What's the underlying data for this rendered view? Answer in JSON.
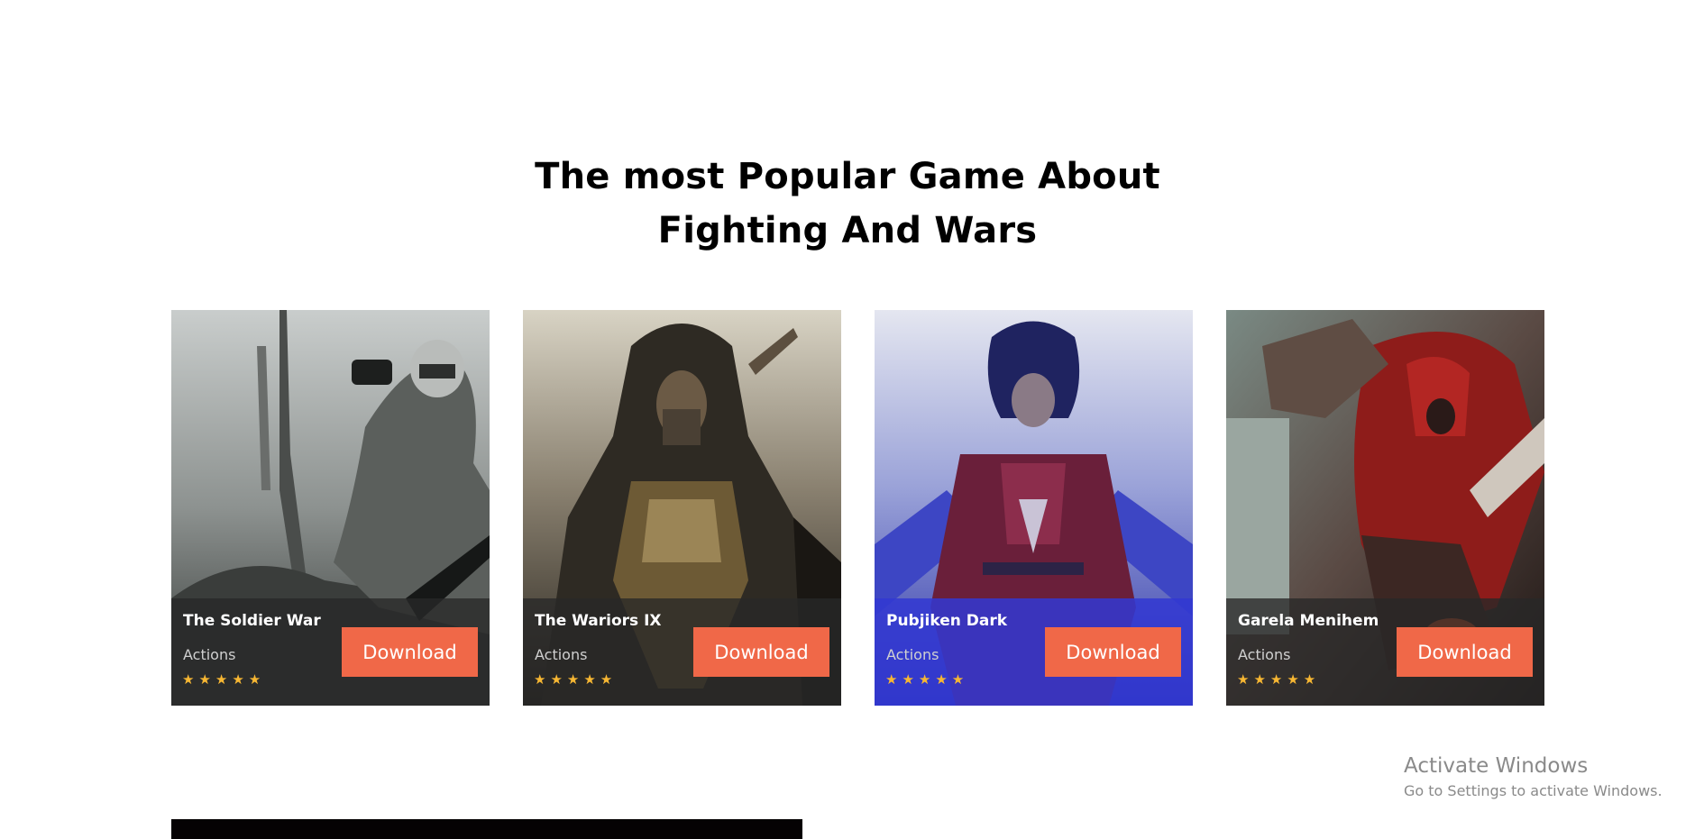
{
  "section": {
    "title_line1": "The most Popular Game About",
    "title_line2": "Fighting And Wars"
  },
  "cards": [
    {
      "name": "The Soldier War",
      "genre": "Actions",
      "stars": "★★★★★",
      "button": "Download",
      "image": "soldier-with-binoculars-art"
    },
    {
      "name": "The Wariors IX",
      "genre": "Actions",
      "stars": "★★★★★",
      "button": "Download",
      "image": "hooded-warrior-art"
    },
    {
      "name": "Pubjiken Dark",
      "genre": "Actions",
      "stars": "★★★★★",
      "button": "Download",
      "image": "dark-knight-red-armor-art"
    },
    {
      "name": "Garela Menihem",
      "genre": "Actions",
      "stars": "★★★★★",
      "button": "Download",
      "image": "red-hooded-rider-art"
    }
  ],
  "watermark": {
    "line1": "Activate Windows",
    "line2": "Go to Settings to activate Windows."
  },
  "colors": {
    "button": "#f06848",
    "star": "#f7b733",
    "overlay_dark": "#282828",
    "overlay_blue": "#3238d2"
  }
}
